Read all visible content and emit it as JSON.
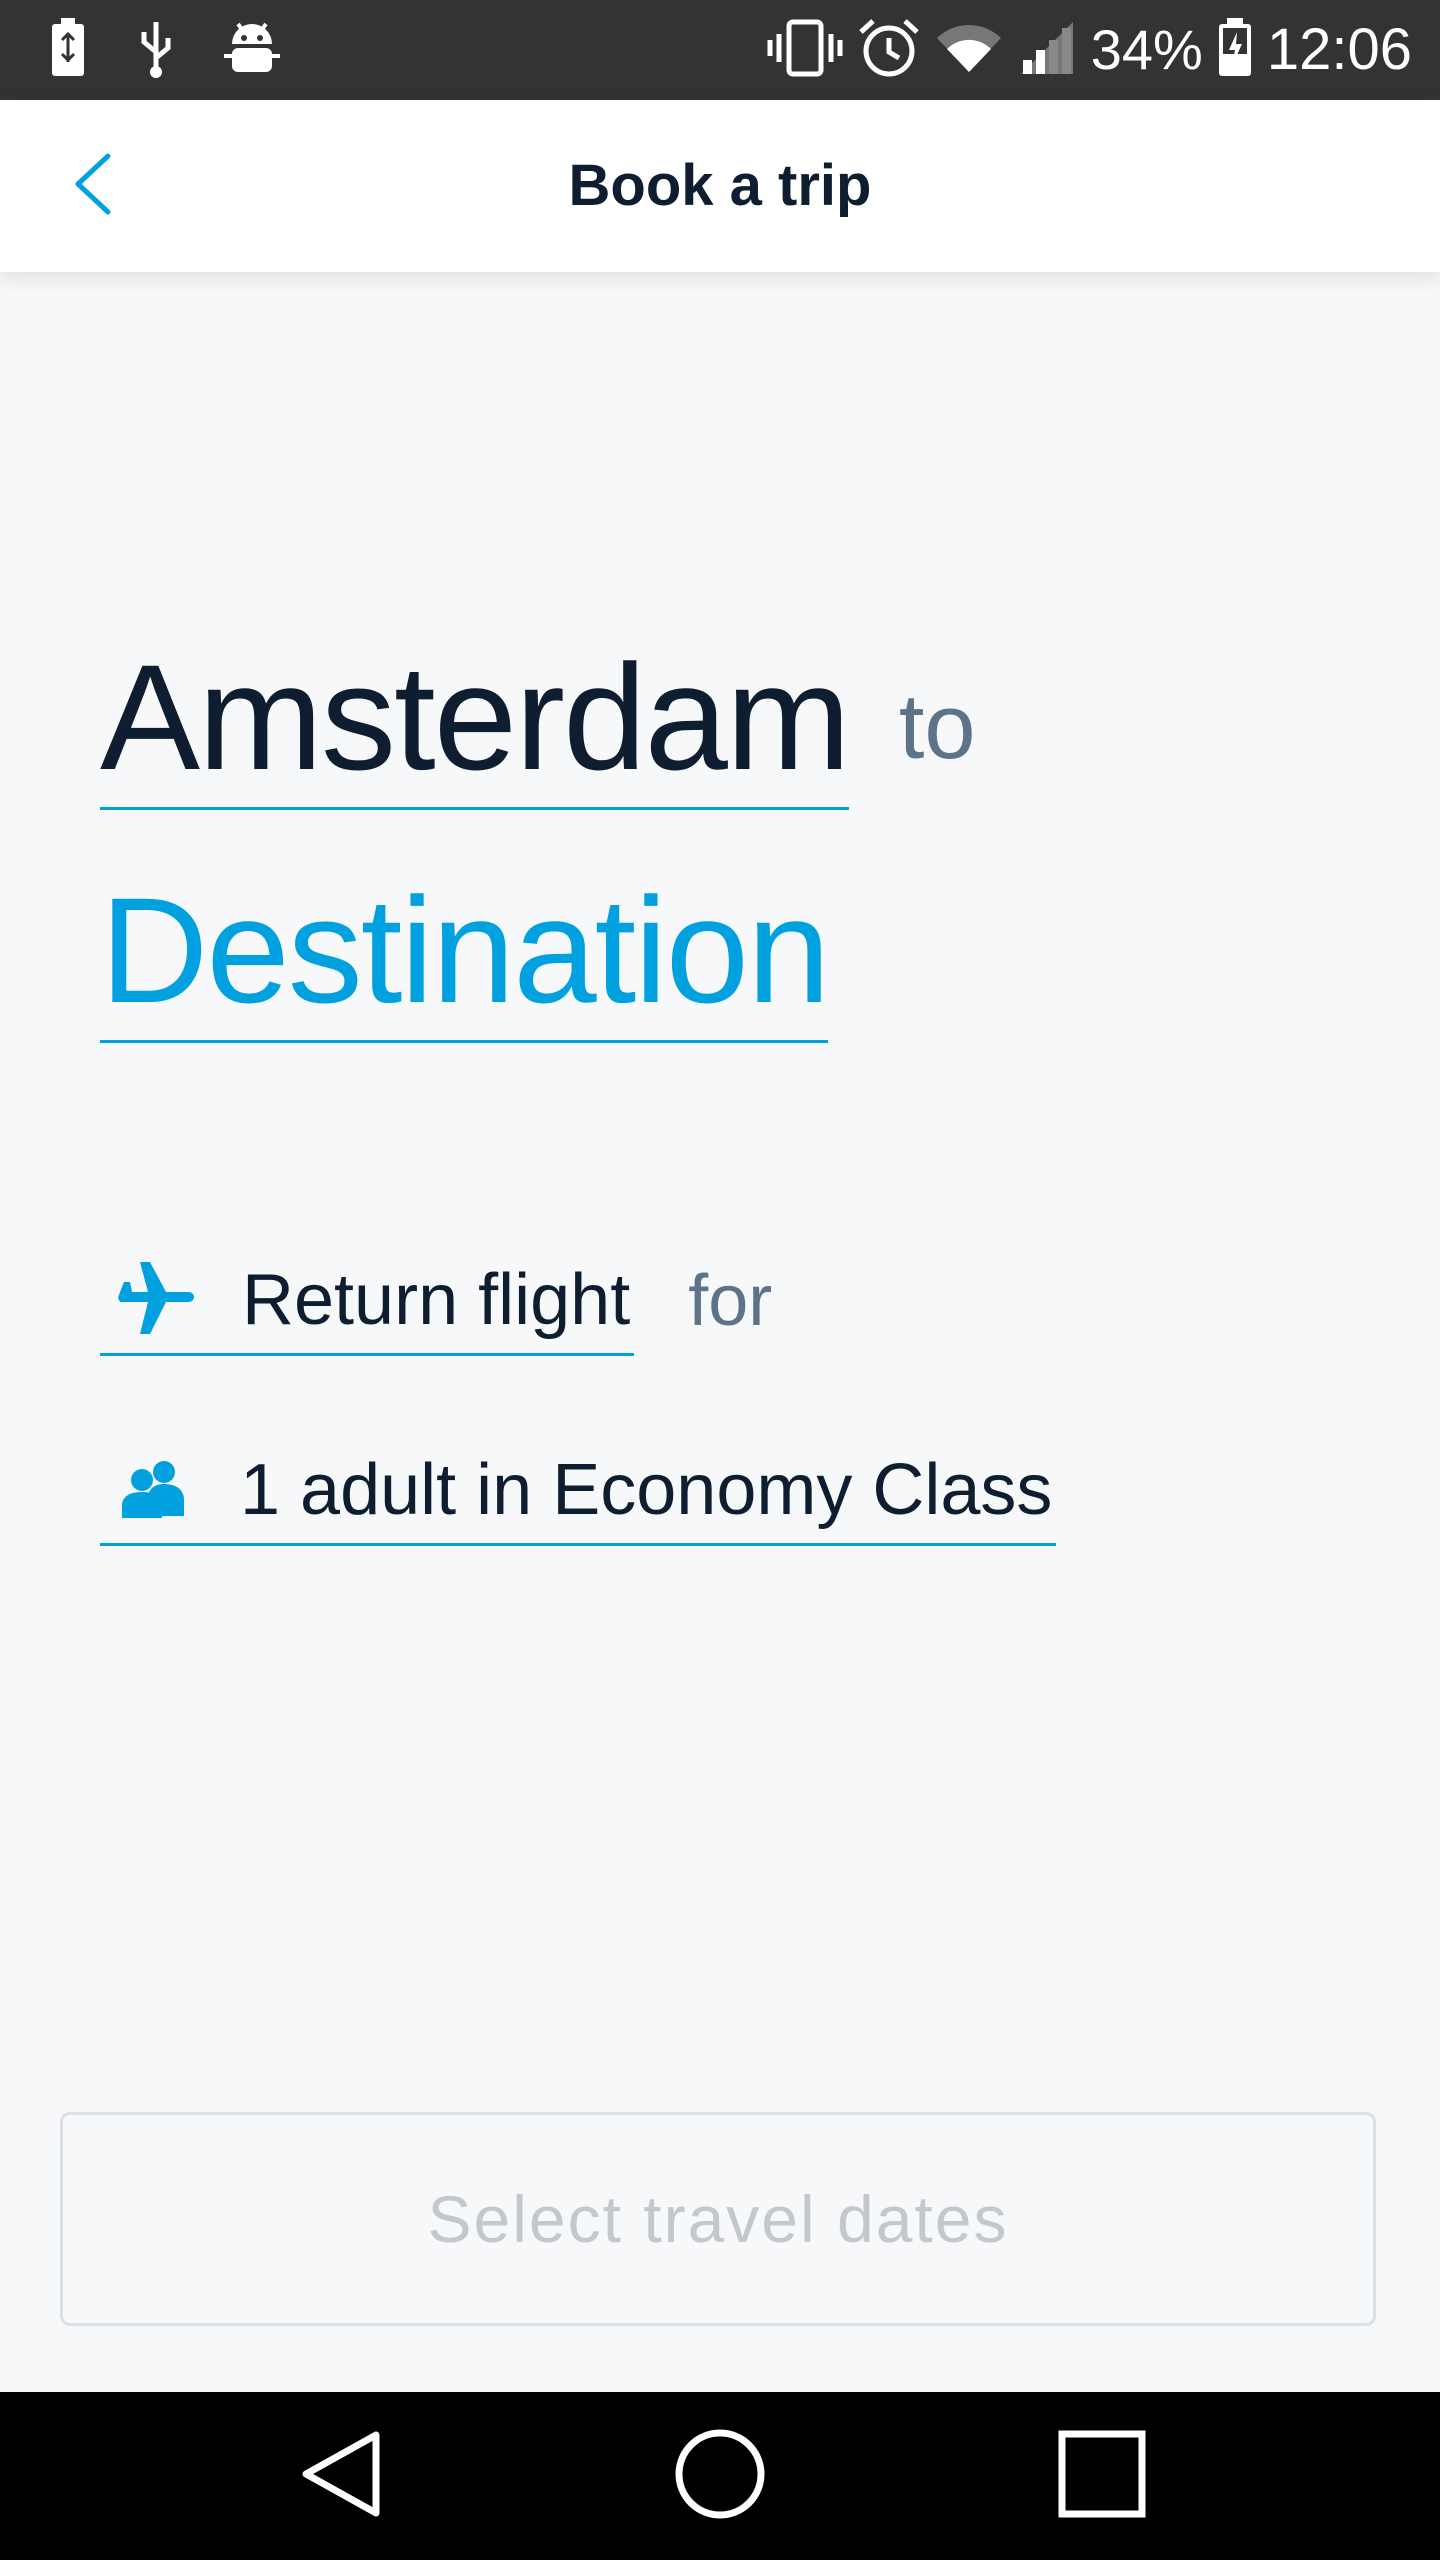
{
  "status_bar": {
    "battery_percent": "34%",
    "time": "12:06",
    "icons_left": [
      "battery-saver-icon",
      "usb-icon",
      "android-debug-icon"
    ],
    "icons_right": [
      "vibrate-icon",
      "alarm-icon",
      "wifi-icon",
      "signal-icon",
      "battery-charging-icon"
    ]
  },
  "app_bar": {
    "title": "Book a trip",
    "back_icon": "chevron-left-icon"
  },
  "route": {
    "origin": "Amsterdam",
    "connector_to": "to",
    "destination_placeholder": "Destination"
  },
  "trip": {
    "trip_type": "Return flight",
    "connector_for": "for",
    "passengers": "1 adult in Economy Class",
    "trip_icon": "airplane-icon",
    "passengers_icon": "people-icon"
  },
  "actions": {
    "select_dates_label": "Select travel dates"
  },
  "colors": {
    "accent": "#00a1de",
    "primary_text": "#0e1e30",
    "secondary_text": "#5c7388",
    "disabled_text": "#c4c8cc",
    "background": "#f7f8fa"
  },
  "nav_bar": {
    "icons": [
      "back-triangle-icon",
      "home-circle-icon",
      "recents-square-icon"
    ]
  }
}
